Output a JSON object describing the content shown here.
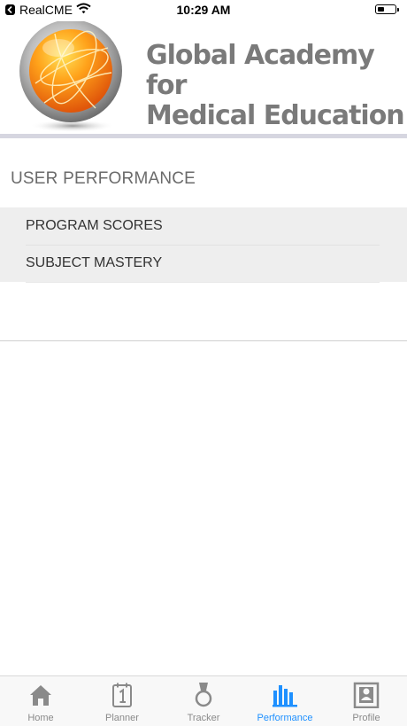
{
  "status_bar": {
    "back_app": "RealCME",
    "time": "10:29 AM"
  },
  "header": {
    "logo_line1": "Global Academy for",
    "logo_line2": "Medical Education"
  },
  "main": {
    "section_title": "USER PERFORMANCE",
    "menu_items": [
      {
        "label": "PROGRAM SCORES"
      },
      {
        "label": "SUBJECT MASTERY"
      }
    ]
  },
  "tab_bar": {
    "active_tab": "Performance",
    "active_color": "#1e90ff",
    "tabs": [
      {
        "label": "Home",
        "icon": "home-icon"
      },
      {
        "label": "Planner",
        "icon": "calendar-icon"
      },
      {
        "label": "Tracker",
        "icon": "medal-icon"
      },
      {
        "label": "Performance",
        "icon": "bar-chart-icon"
      },
      {
        "label": "Profile",
        "icon": "profile-icon"
      }
    ]
  }
}
